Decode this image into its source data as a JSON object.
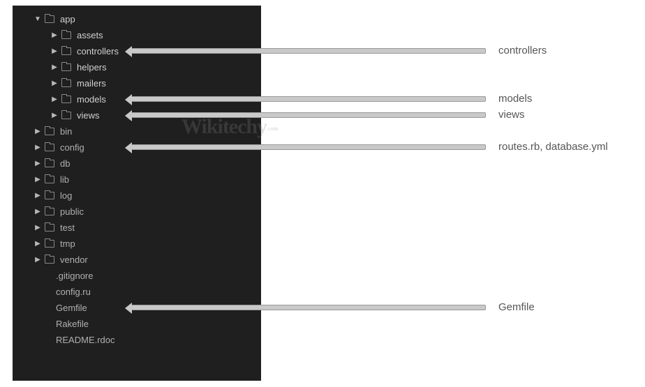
{
  "watermark": {
    "main": "Wikitechy",
    "sub": ".com"
  },
  "tree": {
    "root": {
      "name": "app",
      "children": [
        {
          "name": "assets"
        },
        {
          "name": "controllers"
        },
        {
          "name": "helpers"
        },
        {
          "name": "mailers"
        },
        {
          "name": "models"
        },
        {
          "name": "views"
        }
      ]
    },
    "siblings": [
      {
        "name": "bin",
        "type": "folder"
      },
      {
        "name": "config",
        "type": "folder"
      },
      {
        "name": "db",
        "type": "folder"
      },
      {
        "name": "lib",
        "type": "folder"
      },
      {
        "name": "log",
        "type": "folder"
      },
      {
        "name": "public",
        "type": "folder"
      },
      {
        "name": "test",
        "type": "folder"
      },
      {
        "name": "tmp",
        "type": "folder"
      },
      {
        "name": "vendor",
        "type": "folder"
      },
      {
        "name": ".gitignore",
        "type": "file"
      },
      {
        "name": "config.ru",
        "type": "file"
      },
      {
        "name": "Gemfile",
        "type": "file"
      },
      {
        "name": "Rakefile",
        "type": "file"
      },
      {
        "name": "README.rdoc",
        "type": "file"
      }
    ]
  },
  "callouts": [
    {
      "target": "controllers",
      "text": "controllers"
    },
    {
      "target": "models",
      "text": "models"
    },
    {
      "target": "views",
      "text": "views"
    },
    {
      "target": "config",
      "text": "routes.rb, database.yml"
    },
    {
      "target": "Gemfile",
      "text": "Gemfile"
    }
  ]
}
